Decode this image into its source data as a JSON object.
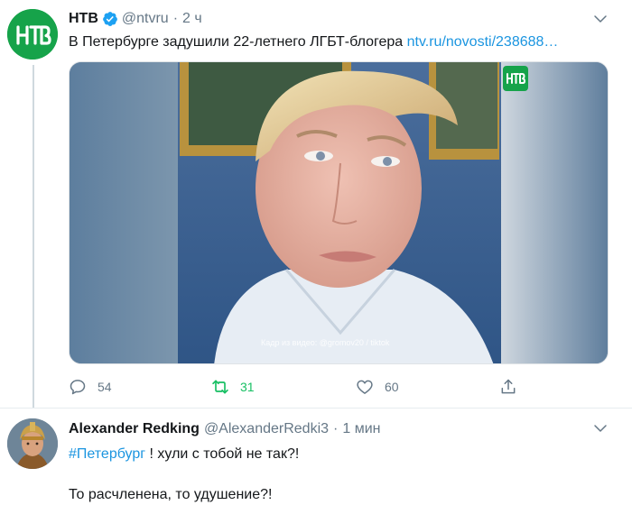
{
  "tweet1": {
    "display_name": "НТВ",
    "handle": "@ntvru",
    "separator": "·",
    "time": "2 ч",
    "text": "В Петербурге задушили 22-летнего ЛГБТ-блогера",
    "link": "ntv.ru/novosti/238688…",
    "avatar_icon": "ntv-logo-icon",
    "media": {
      "caption": "Кадр из видео: @gromov20 / tiktok",
      "badge_icon": "ntv-logo-icon"
    },
    "actions": {
      "reply_count": "54",
      "retweet_count": "31",
      "like_count": "60"
    }
  },
  "tweet2": {
    "display_name": "Alexander Redking",
    "handle": "@AlexanderRedki3",
    "separator": "·",
    "time": "1 мин",
    "hashtag": "#Петербург",
    "line1_rest": " ! хули с тобой не так?!",
    "line2": "То расчленена, то удушение?!"
  },
  "colors": {
    "link": "#1b95e0",
    "muted": "#657786",
    "retweet_active": "#17bf63",
    "ntv_green": "#16a34a",
    "verified": "#1da1f2"
  }
}
